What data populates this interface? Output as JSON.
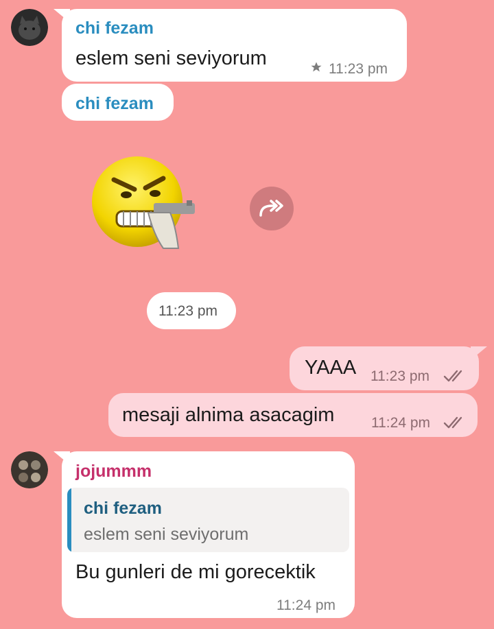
{
  "colors": {
    "background": "#f99a9a",
    "incoming_bubble": "#ffffff",
    "outgoing_bubble": "#fdd6dc",
    "sender_blue": "#2a8dbf",
    "sender_pink": "#c5306b",
    "reply_bar": "#2a8dbf"
  },
  "messages": [
    {
      "sender": "chi fezam",
      "text": "eslem seni seviyorum",
      "time": "11:23 pm",
      "starred": true,
      "icon": "star-icon"
    },
    {
      "sender": "chi fezam",
      "sticker": "angry-emoji-with-gun",
      "forward_icon": "forward-icon"
    },
    {
      "date_chip": "11:23 pm"
    },
    {
      "text": "YAAA",
      "time": "11:23 pm",
      "status_icon": "double-check-icon"
    },
    {
      "text": "mesaji alnima asacagim",
      "time": "11:24 pm",
      "status_icon": "double-check-icon"
    },
    {
      "sender": "jojummm",
      "reply": {
        "sender": "chi fezam",
        "text": "eslem seni seviyorum"
      },
      "text": "Bu gunleri de mi gorecektik",
      "time": "11:24 pm"
    }
  ]
}
